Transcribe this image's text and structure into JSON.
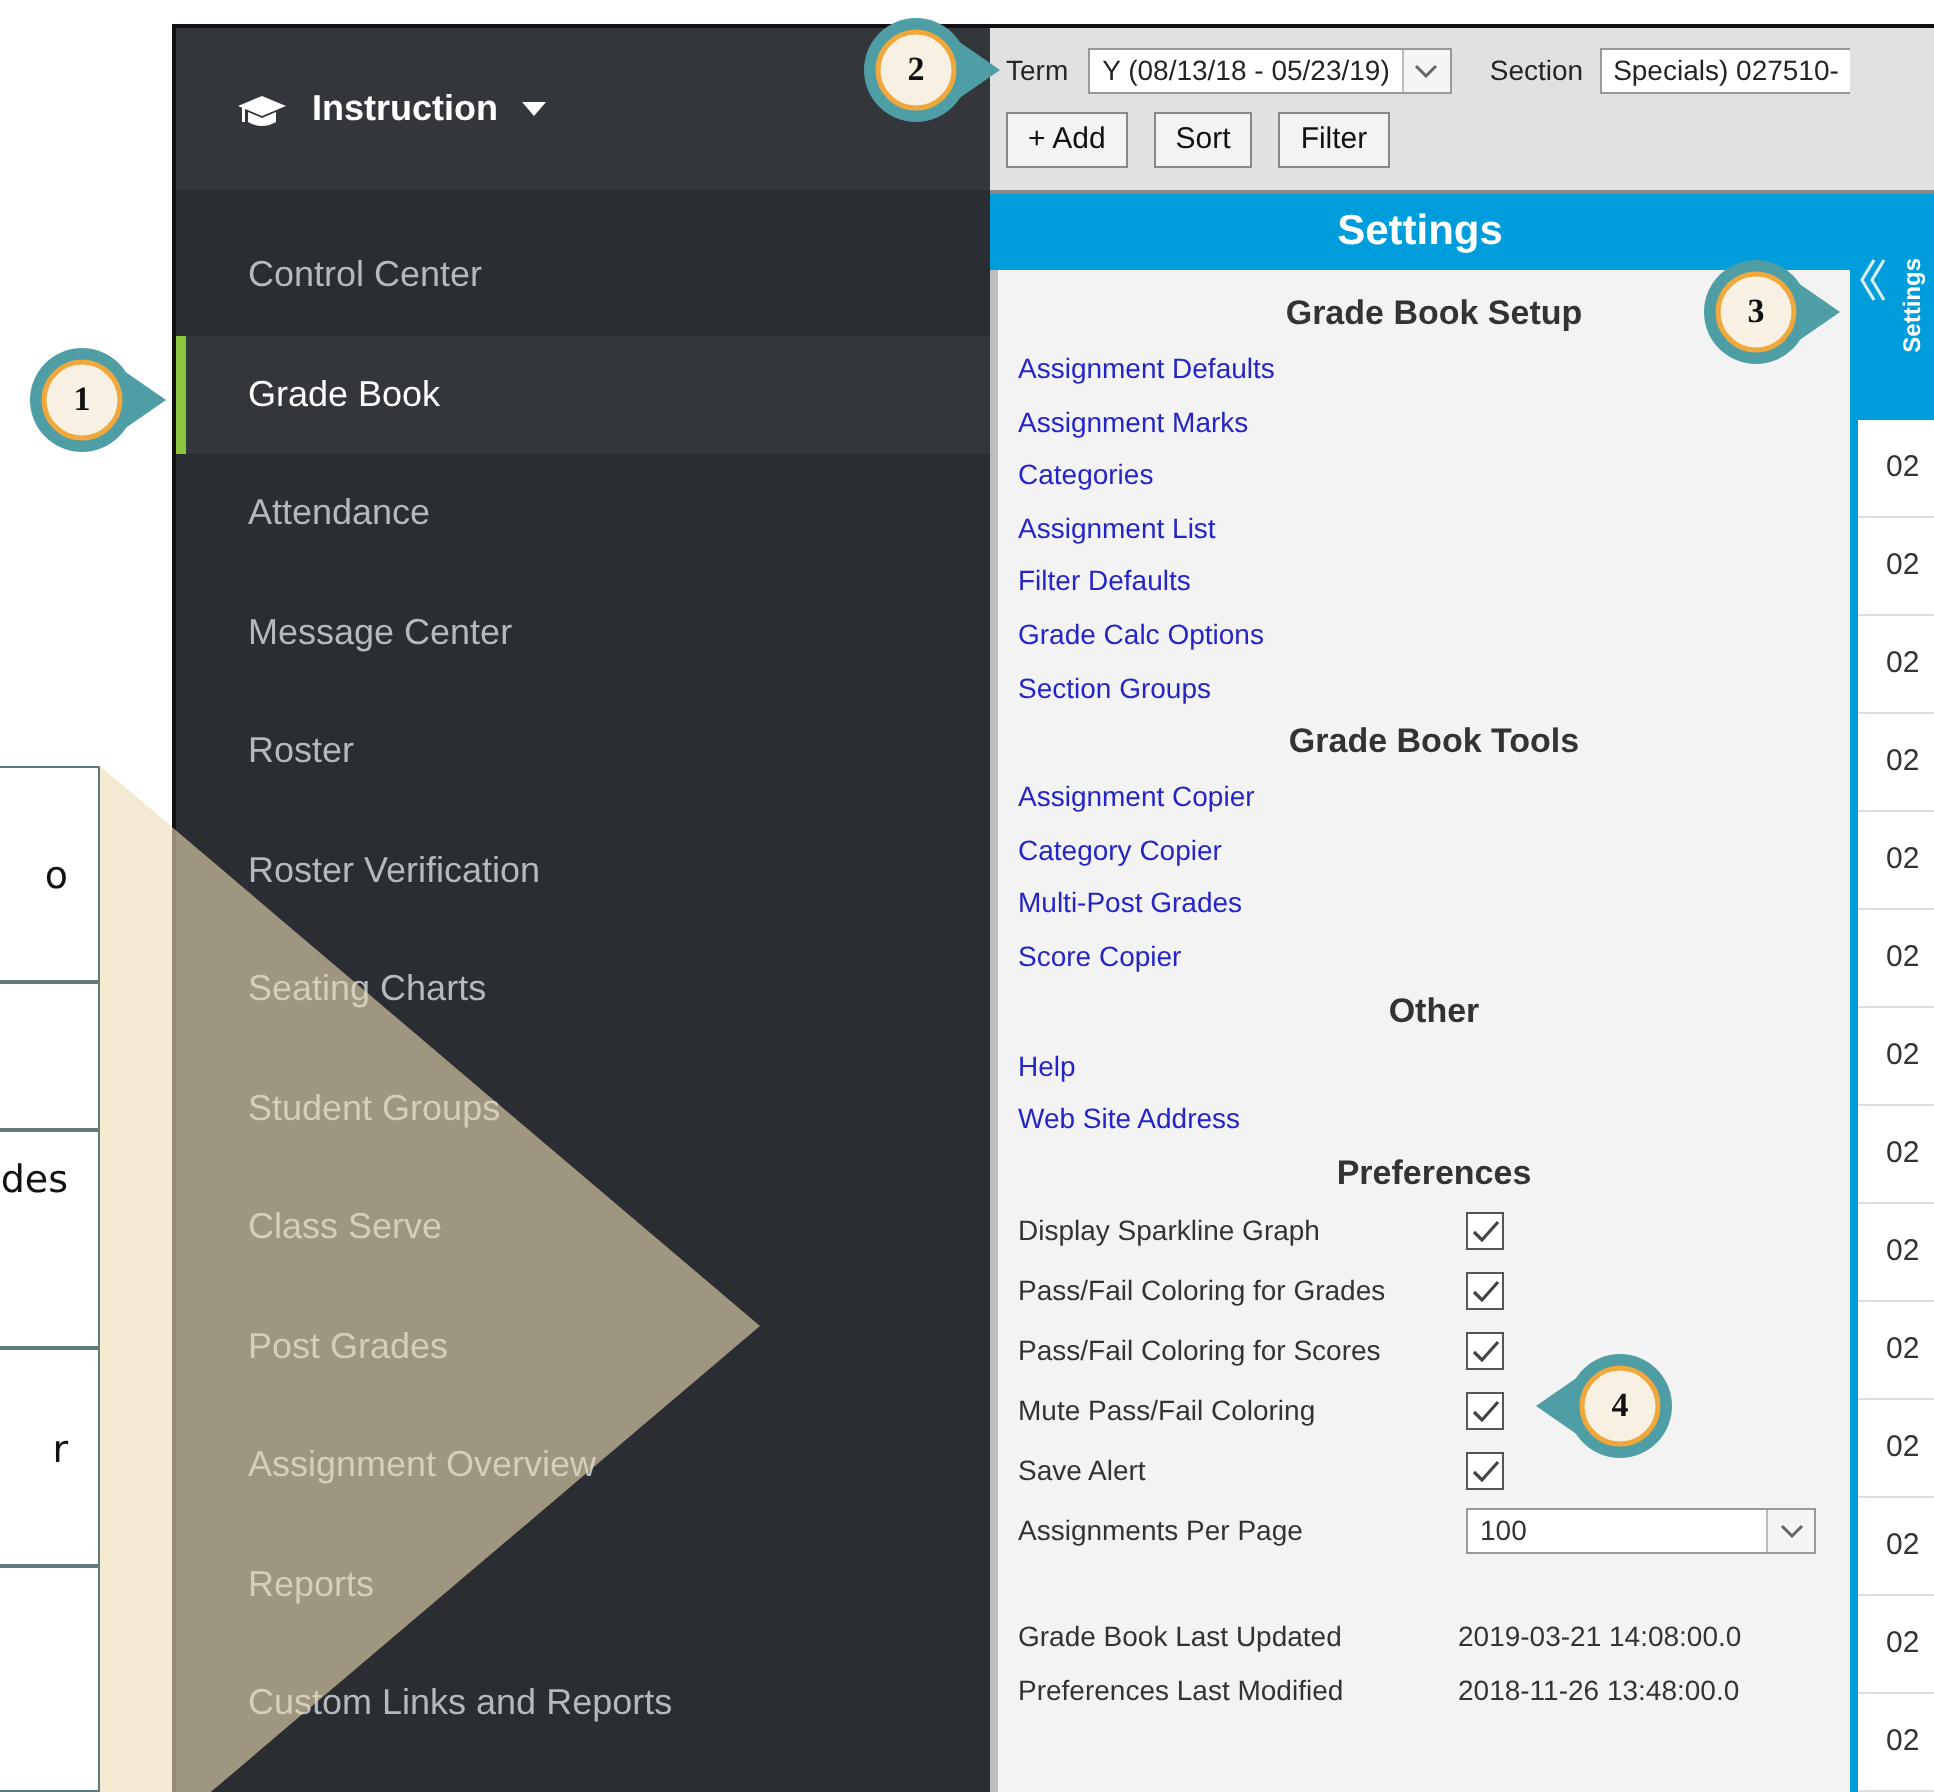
{
  "doc_table": {
    "rows": [
      {
        "text": "o"
      },
      {},
      {
        "text": "des"
      },
      {
        "text": "r"
      },
      {}
    ]
  },
  "sidebar": {
    "title": "Instruction",
    "items": [
      {
        "label": "Control Center",
        "selected": false
      },
      {
        "label": "Grade Book",
        "selected": true
      },
      {
        "label": "Attendance",
        "selected": false
      },
      {
        "label": "Message Center",
        "selected": false
      },
      {
        "label": "Roster",
        "selected": false
      },
      {
        "label": "Roster Verification",
        "selected": false
      },
      {
        "label": "Seating Charts",
        "selected": false
      },
      {
        "label": "Student Groups",
        "selected": false
      },
      {
        "label": "Class Serve",
        "selected": false
      },
      {
        "label": "Post Grades",
        "selected": false
      },
      {
        "label": "Assignment Overview",
        "selected": false
      },
      {
        "label": "Reports",
        "selected": false
      },
      {
        "label": "Custom Links and Reports",
        "selected": false
      }
    ]
  },
  "toolbar": {
    "term_label": "Term",
    "term_value": "Y (08/13/18 - 05/23/19)",
    "section_label": "Section",
    "section_value": "Specials) 027510-",
    "buttons": [
      "+ Add",
      "Sort",
      "Filter"
    ]
  },
  "settings": {
    "title": "Settings",
    "groups": [
      {
        "title": "Grade Book Setup",
        "links": [
          "Assignment Defaults",
          "Assignment Marks",
          "Categories",
          "Assignment List",
          "Filter Defaults",
          "Grade Calc Options",
          "Section Groups"
        ]
      },
      {
        "title": "Grade Book Tools",
        "links": [
          "Assignment Copier",
          "Category Copier",
          "Multi-Post Grades",
          "Score Copier"
        ]
      },
      {
        "title": "Other",
        "links": [
          "Help",
          "Web Site Address"
        ]
      }
    ],
    "preferences": {
      "title": "Preferences",
      "options": [
        {
          "label": "Display Sparkline Graph",
          "checked": true
        },
        {
          "label": "Pass/Fail Coloring for Grades",
          "checked": true
        },
        {
          "label": "Pass/Fail Coloring for Scores",
          "checked": true
        },
        {
          "label": "Mute Pass/Fail Coloring",
          "checked": true
        },
        {
          "label": "Save Alert",
          "checked": true
        }
      ],
      "per_page_label": "Assignments Per Page",
      "per_page_value": "100"
    },
    "info": [
      {
        "label": "Grade Book Last Updated",
        "value": "2019-03-21 14:08:00.0"
      },
      {
        "label": "Preferences Last Modified",
        "value": "2018-11-26 13:48:00.0"
      }
    ]
  },
  "side_strip": {
    "label": "Settings",
    "cells": [
      "02",
      "02",
      "02",
      "02",
      "02",
      "02",
      "02",
      "02",
      "02",
      "02",
      "02",
      "02",
      "02",
      "02"
    ]
  },
  "callouts": [
    {
      "number": "1",
      "kind": "right"
    },
    {
      "number": "2",
      "kind": "right"
    },
    {
      "number": "3",
      "kind": "right"
    },
    {
      "number": "4",
      "kind": "left"
    }
  ]
}
